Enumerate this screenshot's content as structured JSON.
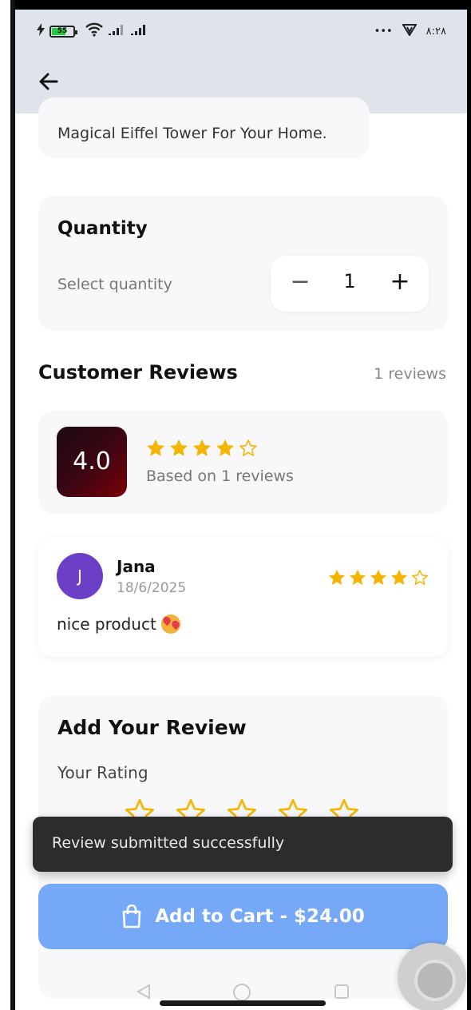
{
  "status_bar": {
    "battery_level": "55",
    "right_dots": "•••",
    "time": "٨:٢٨"
  },
  "product": {
    "description": "Magical Eiffel Tower For Your Home."
  },
  "quantity": {
    "title": "Quantity",
    "label": "Select quantity",
    "minus": "−",
    "value": "1",
    "plus": "+"
  },
  "reviews": {
    "title": "Customer Reviews",
    "count_label": "1 reviews",
    "average": "4.0",
    "average_stars": 4,
    "based_on": "Based on 1 reviews",
    "items": [
      {
        "avatar_letter": "J",
        "name": "Jana",
        "date": "18/6/2025",
        "stars": 4,
        "text": "nice product"
      }
    ]
  },
  "add_review": {
    "title": "Add Your Review",
    "rating_label": "Your Rating",
    "selected_stars": 0
  },
  "toast": {
    "message": "Review submitted successfully"
  },
  "cart": {
    "label": "Add to Cart - $24.00"
  },
  "colors": {
    "accent_button": "#75a8f7",
    "star": "#f5b400",
    "avatar": "#6c3fc7",
    "header_bg": "#dfe4ec"
  }
}
